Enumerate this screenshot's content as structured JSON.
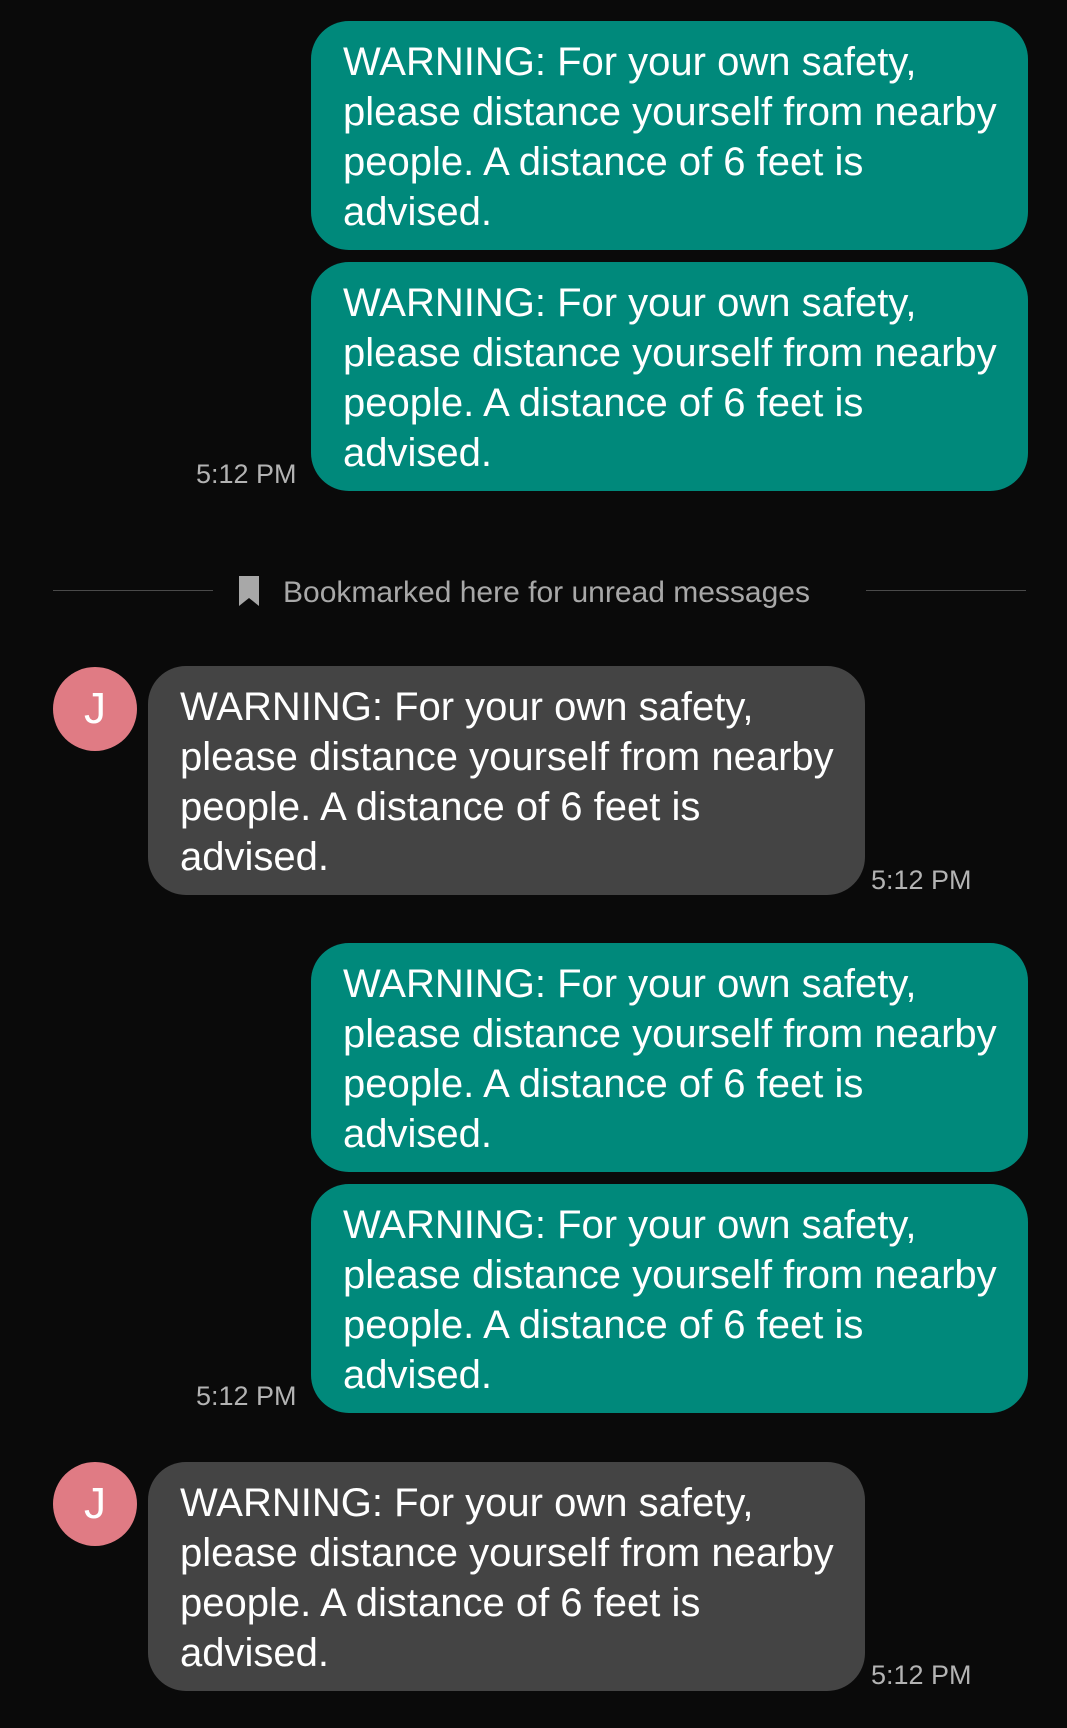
{
  "colors": {
    "background": "#0a0a0a",
    "sent_bubble": "#00897b",
    "received_bubble": "#444444",
    "avatar": "#e07b84",
    "timestamp_text": "#b3b3b3",
    "divider_text": "#a8a8a8"
  },
  "contact": {
    "initial": "J"
  },
  "divider": {
    "icon": "bookmark-icon",
    "label": "Bookmarked here for unread messages"
  },
  "messages": [
    {
      "direction": "sent",
      "text": "WARNING: For your own safety, please distance yourself from nearby people. A distance of 6 feet is advised."
    },
    {
      "direction": "sent",
      "text": "WARNING: For your own safety, please distance yourself from nearby people. A distance of 6 feet is advised.",
      "time": "5:12 PM"
    },
    {
      "direction": "received",
      "text": "WARNING: For your own safety, please distance yourself from nearby people. A distance of 6 feet is advised.",
      "time": "5:12 PM"
    },
    {
      "direction": "sent",
      "text": "WARNING: For your own safety, please distance yourself from nearby people. A distance of 6 feet is advised."
    },
    {
      "direction": "sent",
      "text": "WARNING: For your own safety, please distance yourself from nearby people. A distance of 6 feet is advised.",
      "time": "5:12 PM"
    },
    {
      "direction": "received",
      "text": "WARNING: For your own safety, please distance yourself from nearby people. A distance of 6 feet is advised.",
      "time": "5:12 PM"
    }
  ]
}
